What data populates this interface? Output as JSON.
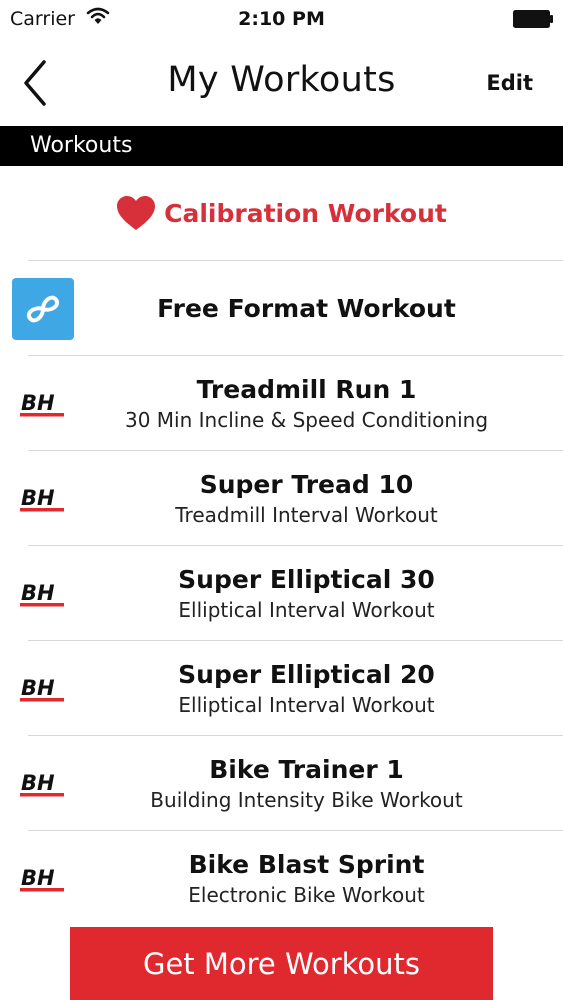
{
  "status": {
    "carrier": "Carrier",
    "time": "2:10 PM"
  },
  "nav": {
    "title": "My Workouts",
    "edit_label": "Edit"
  },
  "section": {
    "title": "Workouts"
  },
  "calibration": {
    "title": "Calibration Workout"
  },
  "free_format": {
    "title": "Free Format Workout"
  },
  "workouts": [
    {
      "title": "Treadmill Run 1",
      "subtitle": "30 Min Incline & Speed Conditioning"
    },
    {
      "title": "Super Tread 10",
      "subtitle": "Treadmill Interval Workout"
    },
    {
      "title": "Super Elliptical 30",
      "subtitle": "Elliptical Interval Workout"
    },
    {
      "title": "Super Elliptical 20",
      "subtitle": "Elliptical Interval Workout"
    },
    {
      "title": "Bike Trainer 1",
      "subtitle": "Building Intensity Bike Workout"
    },
    {
      "title": "Bike Blast Sprint",
      "subtitle": "Electronic Bike Workout"
    }
  ],
  "footer": {
    "button_label": "Get More Workouts"
  },
  "colors": {
    "accent_red": "#e0282f",
    "free_format_blue": "#3fa7e3",
    "header_black": "#000000"
  },
  "icons": [
    "back-chevron-icon",
    "wifi-icon",
    "battery-icon",
    "heart-icon",
    "infinity-icon",
    "bh-logo-icon"
  ]
}
